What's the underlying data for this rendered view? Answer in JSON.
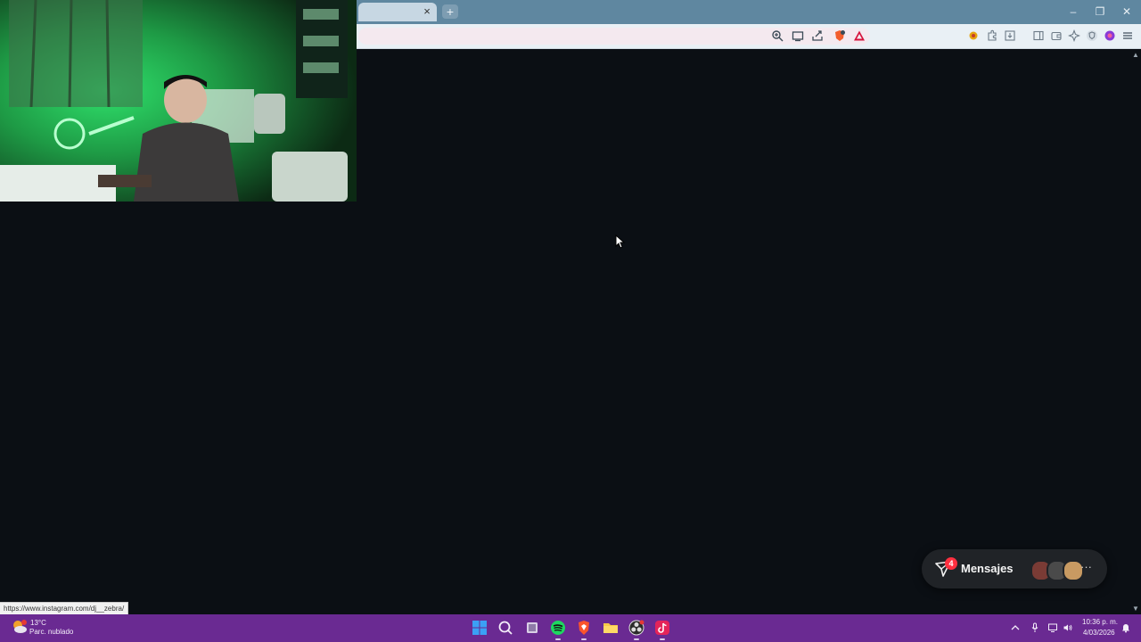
{
  "browser": {
    "tab_close": "×",
    "new_tab": "+",
    "window_controls": {
      "minimize": "–",
      "restore": "❐",
      "close": "✕"
    },
    "toolbar_icons": [
      "zoom-icon",
      "cast-icon",
      "share-icon",
      "brave-shields-icon",
      "brave-rewards-icon",
      "extension-icon",
      "puzzle-icon",
      "sidebar-icon",
      "wallet-icon",
      "vpn-icon",
      "leo-icon",
      "menu-icon"
    ]
  },
  "page": {
    "background": "#0b0f14",
    "status_url": "https://www.instagram.com/dj__zebra/"
  },
  "messages_widget": {
    "label": "Mensajes",
    "badge_count": "4",
    "more": "···"
  },
  "taskbar": {
    "color": "#6a2a92",
    "weather": {
      "temp": "13°C",
      "desc": "Parc. nublado"
    },
    "apps": [
      "windows-start-icon",
      "search-icon",
      "task-view-icon",
      "spotify-icon",
      "brave-icon",
      "file-explorer-icon",
      "obs-icon",
      "tiktok-icon"
    ],
    "clock": {
      "time": "10:36 p. m.",
      "date": "4/03/2026"
    }
  }
}
